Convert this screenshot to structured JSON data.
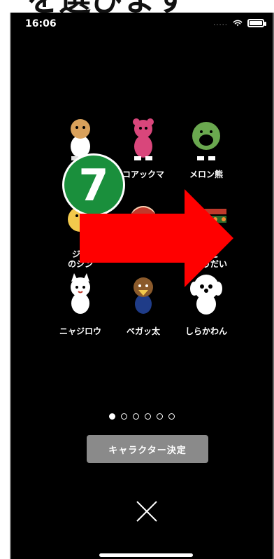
{
  "header": {
    "text": "を選びます"
  },
  "status": {
    "time": "16:06",
    "signal": "....."
  },
  "characters": [
    {
      "name": "",
      "color": "#d9a15b"
    },
    {
      "name": "コアックマ",
      "color": "#d9467b"
    },
    {
      "name": "メロン熊",
      "color": "#6aa84f"
    },
    {
      "name": "ジン\nのジン",
      "color": "#f2c94c"
    },
    {
      "name": "",
      "color": "#ffd1b3"
    },
    {
      "name": "りんこ\nきょうだい",
      "color": "#f28b30"
    },
    {
      "name": "ニャジロウ",
      "color": "#ffffff"
    },
    {
      "name": "ベガッ太",
      "color": "#8b5a2b"
    },
    {
      "name": "しらかわん",
      "color": "#ffffff"
    }
  ],
  "pager": {
    "count": 6,
    "active_index": 0
  },
  "buttons": {
    "decide": "キャラクター決定",
    "close": "×"
  },
  "overlay": {
    "step": "7"
  }
}
